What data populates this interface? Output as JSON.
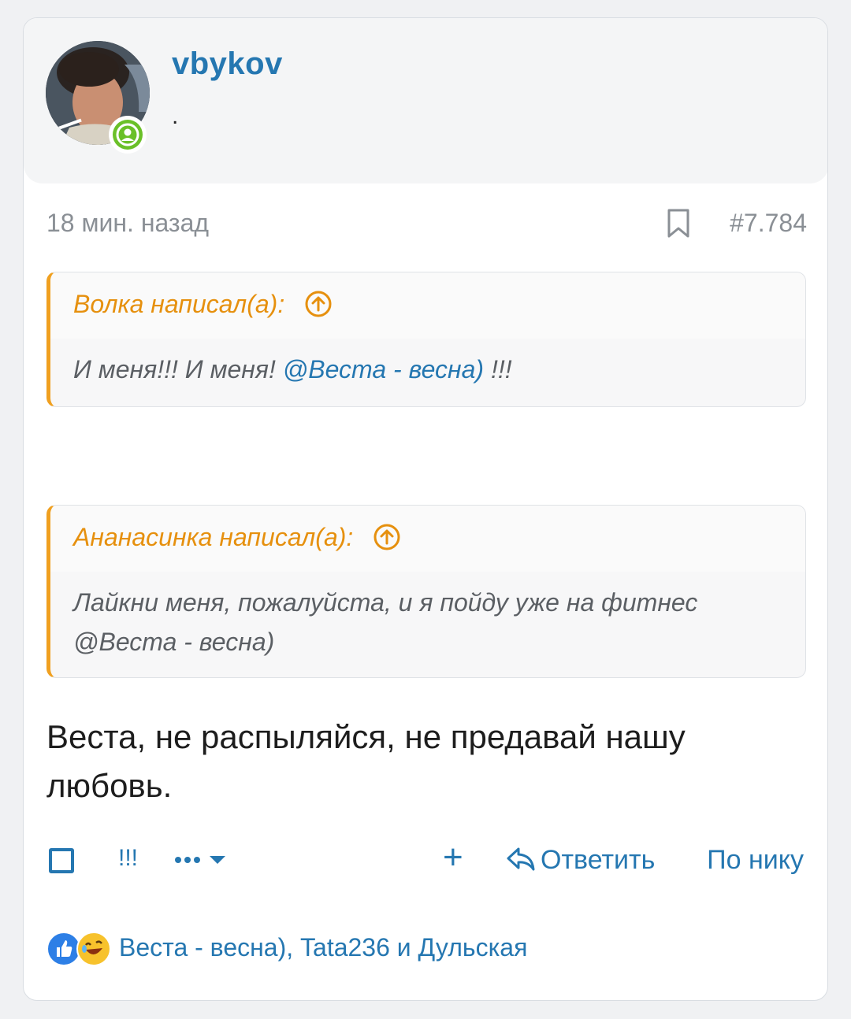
{
  "user": {
    "username": "vbykov",
    "title": ".",
    "online_color": "#6ac028"
  },
  "post": {
    "time": "18 мин. назад",
    "number": "#7.784",
    "bookmark_icon": "bookmark-icon"
  },
  "quotes": [
    {
      "author": "Волка написал(а):",
      "text_before": "И меня!!! И меня! ",
      "mention": "@Веста - весна)",
      "text_after": " !!!"
    },
    {
      "author": "Ананасинка написал(а):",
      "text_before": "Лайкни меня, пожалуйста, и я пойду уже на фитнес ",
      "mention": "",
      "text_after": "@Веста - весна)"
    }
  ],
  "message": "Веста, не распыляйся, не предавай нашу любовь.",
  "actions": {
    "reaction_label": "!!!",
    "plus_label": "+",
    "reply_label": "Ответить",
    "nick_label": "По нику"
  },
  "reactions": {
    "users": "Веста - весна), Tata236 и Дульская"
  },
  "colors": {
    "accent": "#2577b1",
    "quote_author": "#e6900e",
    "quote_border": "#f0a020"
  }
}
